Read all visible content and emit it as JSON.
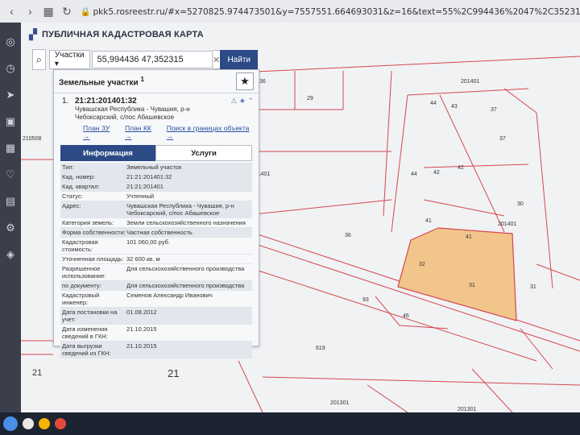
{
  "browser": {
    "url": "pkk5.rosreestr.ru/#x=5270825.974473501&y=7557551.664693031&z=16&text=55%2C994436%2047%2C352315&type=1&app=search&opened=1",
    "back_icon": "back-arrow-icon",
    "forward_icon": "forward-arrow-icon",
    "menu_icon": "grid-icon",
    "reload_icon": "reload-icon"
  },
  "header": {
    "title": "ПУБЛИЧНАЯ КАДАСТРОВАЯ КАРТА"
  },
  "search": {
    "type_select": "Участки ▾",
    "value": "55,994436 47,352315",
    "clear": "✕",
    "button": "Найти"
  },
  "panel": {
    "title": "Земельные участки",
    "title_sup": "1",
    "result": {
      "index": "1.",
      "cadastral_number": "21:21:201401:32",
      "address_line1": "Чувашская Республика - Чувашия, р-н",
      "address_line2": "Чебоксарский, с/пос Абашевское"
    },
    "links": [
      "План ЗУ →",
      "План КК →",
      "Поиск в границах объекта →"
    ],
    "tabs": [
      "Информация",
      "Услуги"
    ],
    "properties": [
      {
        "label": "Тип:",
        "value": "Земельный участок"
      },
      {
        "label": "Кад. номер:",
        "value": "21:21:201401:32"
      },
      {
        "label": "Кад. квартал:",
        "value": "21:21:201401"
      },
      {
        "label": "Статус:",
        "value": "Учтенный"
      },
      {
        "label": "Адрес:",
        "value": "Чувашская Республика - Чувашия, р-н Чебоксарский, с/пос Абашевское"
      },
      {
        "label": "Категория земель:",
        "value": "Земли сельскохозяйственного назначения"
      },
      {
        "label": "Форма собственности:",
        "value": "Частная собственность"
      },
      {
        "label": "Кадастровая стоимость:",
        "value": "101 060,00 руб."
      },
      {
        "label": "Уточненная площадь:",
        "value": "32 600 кв. м"
      },
      {
        "label": "Разрешенное использование:",
        "value": "Для сельскохозяйственного производства"
      },
      {
        "label": "по документу:",
        "value": "Для сельскохозяйственного производства"
      },
      {
        "label": "Кадастровый инженер:",
        "value": "Семенов Александр Иванович"
      },
      {
        "label": "Дата постановки на учет:",
        "value": "01.08.2012"
      },
      {
        "label": "Дата изменения сведений в ГКН:",
        "value": "21.10.2015"
      },
      {
        "label": "Дата выгрузки сведений из ГКН:",
        "value": "21.10.2015"
      }
    ]
  },
  "map": {
    "labels": [
      "201401",
      "36",
      "29",
      "44",
      "43",
      "37",
      "37",
      "42",
      "44",
      "42",
      "201401",
      "30",
      "41",
      "41",
      "201401",
      "36",
      "32",
      "31",
      "31",
      "93",
      "46",
      "619",
      "21",
      "21",
      "201301",
      "201301",
      "210508"
    ],
    "highlight_color": "#f2c58a",
    "line_color": "#d4484e"
  }
}
